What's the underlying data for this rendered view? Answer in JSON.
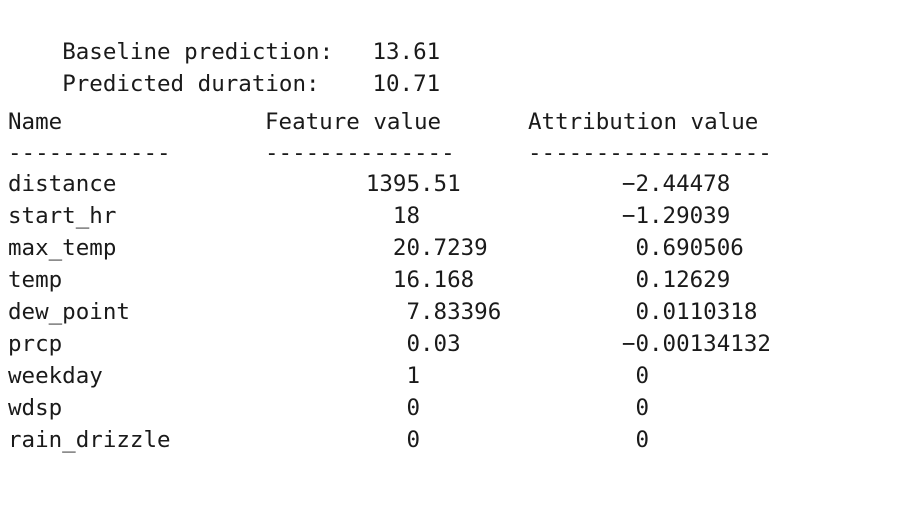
{
  "summary": {
    "baseline": {
      "label": "Baseline prediction:",
      "value": "13.61"
    },
    "predicted": {
      "label": "Predicted duration:",
      "value": "10.71"
    }
  },
  "table": {
    "headers": {
      "name": "Name",
      "feature_value": "Feature value",
      "attribution_value": "Attribution value"
    },
    "separators": {
      "name": "------------",
      "feature_value": "--------------",
      "attribution_value": "------------------"
    },
    "rows": [
      {
        "name": "distance",
        "feature_value": "1395.51",
        "feature_int": "1395",
        "feature_frac": ".51",
        "attribution_value": "-2.44478",
        "attribution_int": "−2",
        "attribution_frac": ".44478"
      },
      {
        "name": "start_hr",
        "feature_value": "18",
        "feature_int": "18",
        "feature_frac": "",
        "attribution_value": "-1.29039",
        "attribution_int": "−1",
        "attribution_frac": ".29039"
      },
      {
        "name": "max_temp",
        "feature_value": "20.7239",
        "feature_int": "20",
        "feature_frac": ".7239",
        "attribution_value": "0.690506",
        "attribution_int": "0",
        "attribution_frac": ".690506"
      },
      {
        "name": "temp",
        "feature_value": "16.168",
        "feature_int": "16",
        "feature_frac": ".168",
        "attribution_value": "0.12629",
        "attribution_int": "0",
        "attribution_frac": ".12629"
      },
      {
        "name": "dew_point",
        "feature_value": "7.83396",
        "feature_int": "7",
        "feature_frac": ".83396",
        "attribution_value": "0.0110318",
        "attribution_int": "0",
        "attribution_frac": ".0110318"
      },
      {
        "name": "prcp",
        "feature_value": "0.03",
        "feature_int": "0",
        "feature_frac": ".03",
        "attribution_value": "-0.00134132",
        "attribution_int": "−0",
        "attribution_frac": ".00134132"
      },
      {
        "name": "weekday",
        "feature_value": "1",
        "feature_int": "1",
        "feature_frac": "",
        "attribution_value": "0",
        "attribution_int": "0",
        "attribution_frac": ""
      },
      {
        "name": "wdsp",
        "feature_value": "0",
        "feature_int": "0",
        "feature_frac": "",
        "attribution_value": "0",
        "attribution_int": "0",
        "attribution_frac": ""
      },
      {
        "name": "rain_drizzle",
        "feature_value": "0",
        "feature_int": "0",
        "feature_frac": "",
        "attribution_value": "0",
        "attribution_int": "0",
        "attribution_frac": ""
      }
    ]
  },
  "colors": {
    "background": "#ffffff",
    "text": "#1a1a1a"
  }
}
